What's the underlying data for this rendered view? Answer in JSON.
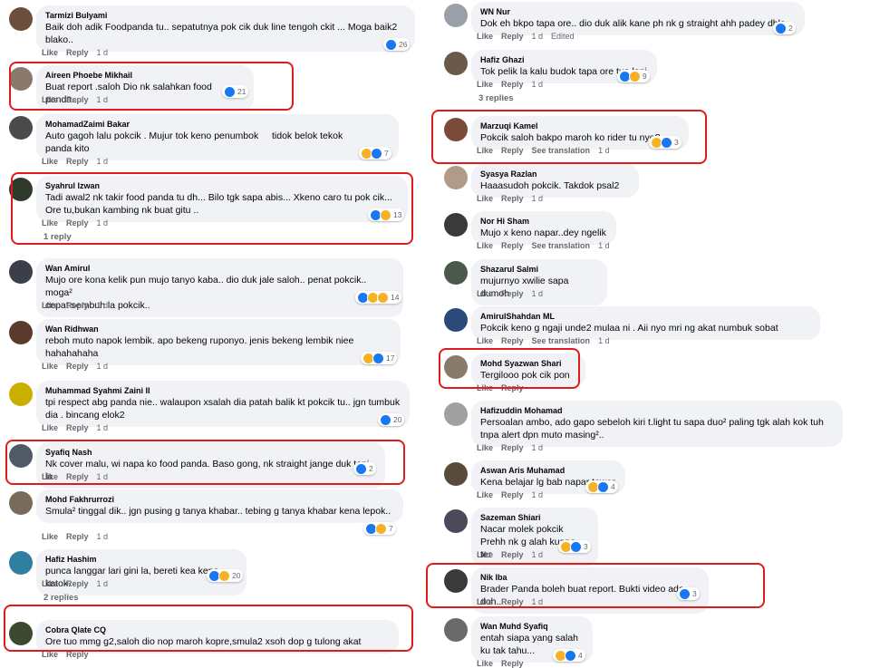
{
  "labels": {
    "like": "Like",
    "reply": "Reply",
    "see_translation": "See translation",
    "edited": "Edited"
  },
  "colors": {
    "highlight": "#e01b1b",
    "bubble": "#f0f2f5",
    "like_blue": "#1877f2",
    "meta_gray": "#65676b"
  },
  "left": [
    {
      "author": "Tarmizi Bulyami",
      "lines": [
        "Baik doh adik Foodpanda tu.. sepatutnya pok cik duk line tengoh ckit ... Moga baik2",
        "blako.."
      ],
      "time": "1 d",
      "reactions": [
        "like"
      ],
      "count": "26",
      "avatar_color": "#6b4f3a"
    },
    {
      "author": "Aireen Phoebe Mikhail",
      "lines": [
        "Buat report .saloh Dio nk salahkan food panda.."
      ],
      "time": "1 d",
      "reactions": [
        "like"
      ],
      "count": "21",
      "avatar_color": "#8a7a6e"
    },
    {
      "author": "MohamadZaimi Bakar",
      "lines": [
        "Auto gagoh lalu pokcik . Mujur tok keno penumbok",
        "panda kito"
      ],
      "emoji_after": "tidok belok tekok",
      "time": "1 d",
      "reactions": [
        "haha",
        "like"
      ],
      "count": "7",
      "avatar_color": "#4a4a4a"
    },
    {
      "author": "Syahrul Izwan",
      "lines": [
        "Tadi awal2 nk takir food panda tu dh... Bilo tgk sapa abis... Xkeno caro tu pok cik...",
        "Ore tu,bukan kambing nk buat gitu .."
      ],
      "time": "1 d",
      "reactions": [
        "like",
        "haha"
      ],
      "count": "13",
      "avatar_color": "#2f3b2a",
      "replies": "1 reply"
    },
    {
      "author": "Wan Amirul",
      "lines": [
        "Mujo ore kona kelik pun mujo tanyo kaba.. dio duk jale saloh.. penat pokcik.. moga²",
        "cepat sembuh la pokcik.."
      ],
      "time": "1 d",
      "reactions": [
        "like",
        "haha",
        "wow"
      ],
      "count": "14",
      "avatar_color": "#3a3f4a"
    },
    {
      "author": "Wan Ridhwan",
      "lines": [
        "reboh muto napok lembik. apo bekeng ruponyo. jenis bekeng lembik niee",
        "hahahahaha"
      ],
      "time": "1 d",
      "reactions": [
        "haha",
        "like"
      ],
      "count": "17",
      "avatar_color": "#5a3a2a"
    },
    {
      "author": "Muhammad Syahmi Zaini II",
      "lines": [
        "tpi respect abg panda nie.. walaupon xsalah dia patah balik kt pokcik tu.. jgn tumbuk",
        "dia . bincang elok2"
      ],
      "time": "1 d",
      "reactions": [
        "like"
      ],
      "count": "20",
      "avatar_color": "#c9b000"
    },
    {
      "author": "Syafiq Nash",
      "lines": [
        "Nk cover malu, wi napa ko food panda. Baso gong, nk straight jange duk tepi la"
      ],
      "time": "1 d",
      "reactions": [
        "like"
      ],
      "count": "2",
      "avatar_color": "#4f5a66"
    },
    {
      "author": "Mohd Fakhrurrozi",
      "lines": [
        "Smula² tinggal dik.. jgn pusing g tanya khabar.. tebing g tanya khabar kena lepok..",
        ""
      ],
      "time": "1 d",
      "reactions": [
        "like",
        "haha"
      ],
      "count": "7",
      "avatar_color": "#7a6a5a"
    },
    {
      "author": "Hafiz Hashim",
      "lines": [
        "punca langgar lari gini la, bereti kea kena katok."
      ],
      "time": "1 d",
      "reactions": [
        "like",
        "haha"
      ],
      "count": "20",
      "avatar_color": "#2e7fa0",
      "replies": "2 replies"
    },
    {
      "author": "Cobra Qlate CQ",
      "lines": [
        "Ore tuo mmg g2,saloh dio nop maroh kopre,smula2 xsoh dop g tulong akat"
      ],
      "time": "",
      "reactions": [],
      "count": "",
      "avatar_color": "#3b4a2e"
    }
  ],
  "right": [
    {
      "author": "WN Nur",
      "lines": [
        "Dok eh bkpo tapa ore..  dio duk alik kane ph nk g straight ahh padey dhla"
      ],
      "time": "1 d",
      "edited": true,
      "reactions": [
        "like"
      ],
      "count": "2",
      "avatar_color": "#9aa0a8"
    },
    {
      "author": "Hafiz Ghazi",
      "lines": [
        "Tok pelik la kalu budok tapa ore tua lani"
      ],
      "time": "1 d",
      "reactions": [
        "like",
        "haha"
      ],
      "count": "9",
      "avatar_color": "#6a5a4a",
      "replies": "3 replies"
    },
    {
      "author": "Marzuqi Kamel",
      "lines": [
        "Pokcik saloh bakpo maroh ko rider tu nyo?"
      ],
      "time": "1 d",
      "translate": true,
      "reactions": [
        "haha",
        "like"
      ],
      "count": "3",
      "avatar_color": "#7a4a3a"
    },
    {
      "author": "Syasya Razlan",
      "lines": [
        "Haaasudoh pokcik. Takdok psal2"
      ],
      "time": "1 d",
      "reactions": [],
      "count": "",
      "avatar_color": "#b09a8a"
    },
    {
      "author": "Nor Hi Sham",
      "lines": [
        "Mujo x keno napar..dey ngelik"
      ],
      "time": "1 d",
      "translate": true,
      "reactions": [],
      "count": "",
      "avatar_color": "#3a3a3a"
    },
    {
      "author": "Shazarul Salmi",
      "lines": [
        "mujurnyo xwilie sapa dumoh"
      ],
      "time": "1 d",
      "reactions": [],
      "count": "",
      "avatar_color": "#4a5a4a"
    },
    {
      "author": "AmirulShahdan ML",
      "lines": [
        "Pokcik keno g ngaji unde2 mulaa ni . Aii nyo mri ng akat numbuk sobat"
      ],
      "time": "1 d",
      "translate": true,
      "reactions": [],
      "count": "",
      "avatar_color": "#2a4a7a"
    },
    {
      "author": "Mohd Syazwan Shari",
      "lines": [
        "Tergilooo pok cik pon"
      ],
      "time": "",
      "reactions": [],
      "count": "",
      "avatar_color": "#8a7a6a"
    },
    {
      "author": "Hafizuddin Mohamad",
      "lines": [
        "Persoalan ambo, ado gapo sebeloh kiri t.light tu sapa duo² paling tgk alah kok tuh",
        "tnpa alert dpn muto masing².."
      ],
      "time": "1 d",
      "reactions": [],
      "count": "",
      "avatar_color": "#a0a0a0"
    },
    {
      "author": "Aswan Aris Muhamad",
      "lines": [
        "Kena belajar lg bab napar tawar"
      ],
      "time": "1 d",
      "reactions": [
        "haha",
        "like"
      ],
      "count": "4",
      "avatar_color": "#5a4a3a"
    },
    {
      "author": "Sazeman Shiari",
      "lines": [
        "Nacar molek pokcik",
        "Prehh nk g alah kuano ter"
      ],
      "time": "1 d",
      "reactions": [
        "haha",
        "like"
      ],
      "count": "3",
      "avatar_color": "#4a4a5a"
    },
    {
      "author": "Nik Iba",
      "lines": [
        "Brader Panda boleh buat report. Bukti video ada doh.."
      ],
      "time": "1 d",
      "reactions": [
        "like"
      ],
      "count": "3",
      "avatar_color": "#3a3a3a"
    },
    {
      "author": "Wan Muhd Syafiq",
      "lines": [
        "entah siapa yang salah",
        "ku tak tahu..."
      ],
      "time": "",
      "reactions": [
        "haha",
        "like"
      ],
      "count": "4",
      "avatar_color": "#6a6a6a"
    }
  ]
}
